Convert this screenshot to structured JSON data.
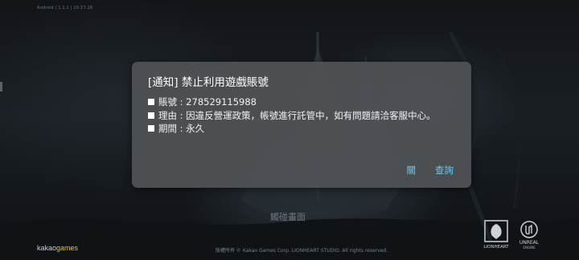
{
  "status_bar": {
    "version_text": "Android | 1.1.1 | 19.17.16"
  },
  "notice_dialog": {
    "title": "[通知] 禁止利用遊戲賬號",
    "account_line": "賬號 : 278529115988",
    "reason_line": "理由 : 因違反營運政策，帳號進行託管中，如有問題請洽客服中心。",
    "period_line": "期間 : 永久",
    "close_label": "關",
    "inquiry_label": "查詢",
    "button_color": "#6ec8ee",
    "background_color": "#4e5154"
  },
  "background": {
    "tap_to_start_text": "觸碰畫面",
    "copyright_text": "版權所有 © Kakao Games Corp. LIONHEART STUDIO. All rights reserved.",
    "publisher_logo_part1": "kakao",
    "publisher_logo_part2": "games",
    "lionheart_logo_text": "LIONHEART",
    "unreal_logo_text": "UNREAL",
    "unreal_logo_subtext": "ENGINE"
  }
}
